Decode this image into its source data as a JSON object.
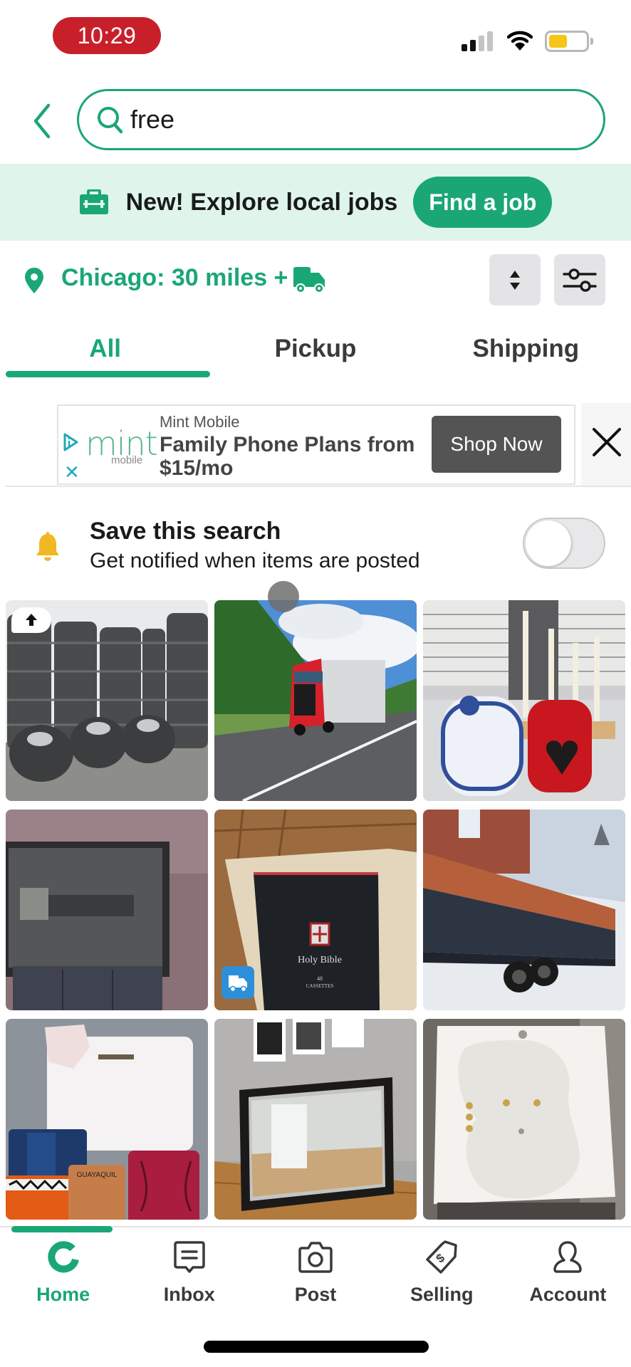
{
  "status_bar": {
    "time": "10:29",
    "signal_bars_active": 2,
    "signal_bars_total": 4,
    "battery_level": 0.5,
    "colors": {
      "time_pill": "#c8202a",
      "battery_fill": "#f5c518"
    }
  },
  "search": {
    "back_icon": "chevron-left-icon",
    "search_icon": "search-icon",
    "query": "free"
  },
  "jobs_banner": {
    "icon": "briefcase-icon",
    "text": "New! Explore local jobs",
    "button_label": "Find a job"
  },
  "location": {
    "icon": "map-pin-icon",
    "label": "Chicago: 30 miles +",
    "shipping_icon": "truck-icon",
    "sort_icon": "sort-icon",
    "filter_icon": "sliders-icon"
  },
  "tabs": [
    {
      "label": "All",
      "active": true
    },
    {
      "label": "Pickup",
      "active": false
    },
    {
      "label": "Shipping",
      "active": false
    }
  ],
  "ad": {
    "logo_text": "mint",
    "logo_subtext": "mobile",
    "brand": "Mint Mobile",
    "headline": "Family Phone Plans from $15/mo",
    "cta": "Shop Now",
    "adchoices_icon": "adchoices-icon",
    "small_close": "✕",
    "close_icon": "close-icon"
  },
  "save_search": {
    "icon": "bell-icon",
    "title": "Save this search",
    "subtitle": "Get notified when items are posted",
    "toggle_on": false
  },
  "listings": [
    {
      "subject": "Stacked used truck tires",
      "badge": "boost-arrow"
    },
    {
      "subject": "Red semi truck on highway",
      "badge": null
    },
    {
      "subject": "Blue & white jar and red heart candle holder",
      "badge": null
    },
    {
      "subject": "Rear-projection TV",
      "badge": null
    },
    {
      "subject": "Holy Bible 48 cassettes set",
      "badge": "shipping"
    },
    {
      "subject": "Trailer with wooden sides",
      "badge": null
    },
    {
      "subject": "Assorted purses and wallets",
      "badge": null
    },
    {
      "subject": "Large framed mirror",
      "badge": null
    },
    {
      "subject": "White jetted bathtub",
      "badge": null
    }
  ],
  "bottom_nav": [
    {
      "label": "Home",
      "icon": "home-logo-icon",
      "active": true
    },
    {
      "label": "Inbox",
      "icon": "inbox-icon",
      "active": false
    },
    {
      "label": "Post",
      "icon": "camera-icon",
      "active": false
    },
    {
      "label": "Selling",
      "icon": "price-tag-icon",
      "active": false
    },
    {
      "label": "Account",
      "icon": "person-icon",
      "active": false
    }
  ],
  "theme": {
    "accent": "#1aa775",
    "banner_bg": "#dff5ec",
    "ad_button": "#545454"
  }
}
